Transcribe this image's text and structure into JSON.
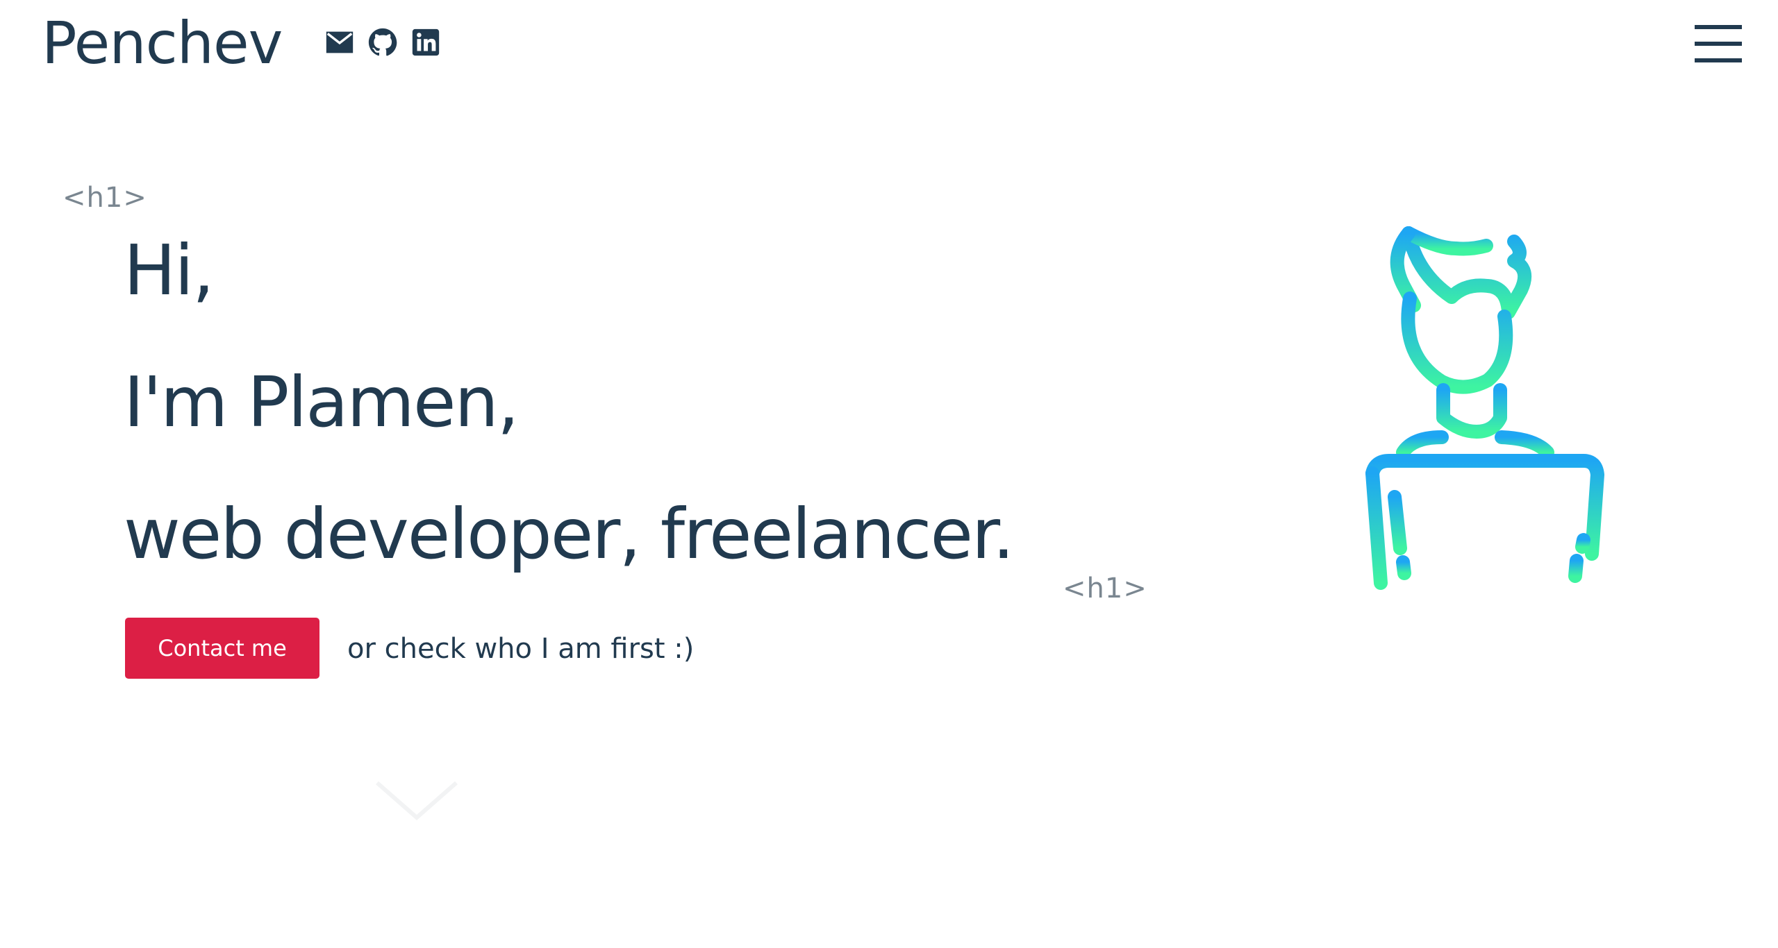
{
  "header": {
    "brand": "Penchev",
    "socials": [
      {
        "name": "email",
        "icon": "mail-icon"
      },
      {
        "name": "github",
        "icon": "github-icon"
      },
      {
        "name": "linkedin",
        "icon": "linkedin-icon"
      }
    ],
    "menu_icon": "hamburger-menu-icon"
  },
  "hero": {
    "tag_open": "<h1>",
    "tag_close": "<h1>",
    "line1": "Hi,",
    "line2": "I'm Plamen,",
    "line3": "web developer, freelancer.",
    "contact_label": "Contact me",
    "aside": "or check who I am first :)",
    "scroll_icon": "chevron-down-icon",
    "illustration_icon": "developer-laptop-icon"
  },
  "colors": {
    "text": "#213a4f",
    "accent": "#dc1f45",
    "tag": "#7a8690",
    "gradient_top": "#1ea6f3",
    "gradient_bottom": "#3ef4a1"
  }
}
